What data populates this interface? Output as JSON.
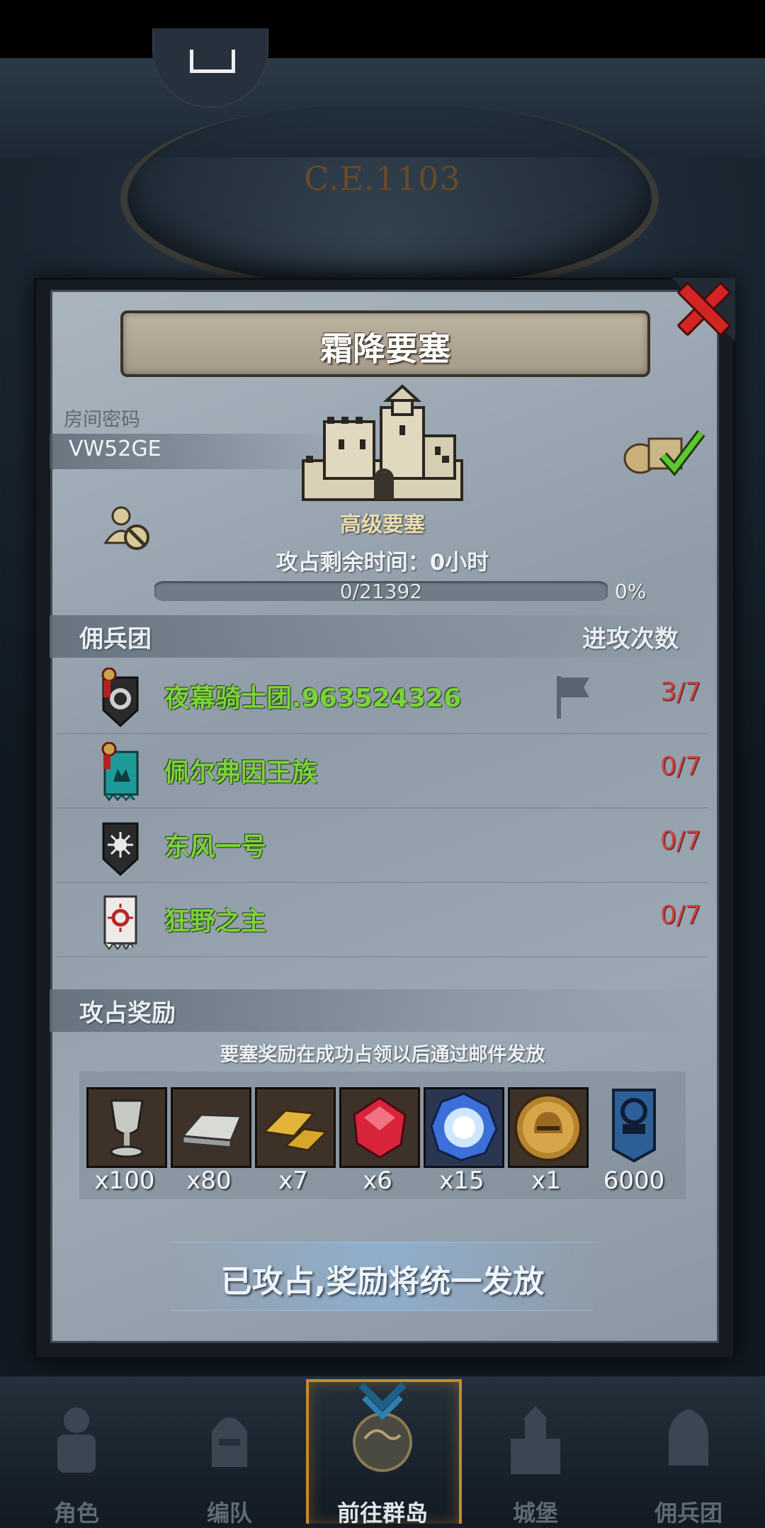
{
  "header": {
    "era_text": "C.E.1103"
  },
  "dialog": {
    "title": "霜降要塞",
    "room_label": "房间密码",
    "room_code": "VW52GE",
    "fortress_type": "高级要塞",
    "remaining_time": "攻占剩余时间：0小时",
    "progress": {
      "text": "0/21392",
      "percent_text": "0%",
      "value": 0,
      "max": 21392
    },
    "mercenary_header": "佣兵团",
    "attack_header": "进攻次数",
    "mercenaries": [
      {
        "name": "夜幕骑士团.963524326",
        "count": "3/7",
        "badge": "black-ring-shield-icon",
        "flag": true
      },
      {
        "name": "佩尔弗因王族",
        "count": "0/7",
        "badge": "teal-crown-banner-icon",
        "flag": false
      },
      {
        "name": "东风一号",
        "count": "0/7",
        "badge": "sun-shield-icon",
        "flag": false
      },
      {
        "name": "狂野之主",
        "count": "0/7",
        "badge": "red-sun-banner-icon",
        "flag": false
      }
    ],
    "reward_header": "攻占奖励",
    "reward_note": "要塞奖励在成功占领以后通过邮件发放",
    "rewards": [
      {
        "icon": "silver-goblet-icon",
        "count": "x100"
      },
      {
        "icon": "silver-ingot-icon",
        "count": "x80"
      },
      {
        "icon": "gold-bars-icon",
        "count": "x7"
      },
      {
        "icon": "red-gem-icon",
        "count": "x6"
      },
      {
        "icon": "blue-crystal-icon",
        "count": "x15"
      },
      {
        "icon": "golden-helmet-coin-icon",
        "count": "x1"
      },
      {
        "icon": "blue-banner-icon",
        "count": "6000"
      }
    ],
    "claim_text": "已攻占,奖励将统一发放",
    "colors": {
      "name_green": "#7ad23c",
      "count_red": "#cf4040",
      "close_red": "#d22424"
    }
  },
  "nav": {
    "items": [
      {
        "label": "角色",
        "icon": "knight-icon"
      },
      {
        "label": "编队",
        "icon": "formation-icon"
      },
      {
        "label": "前往群岛",
        "icon": "globe-icon"
      },
      {
        "label": "城堡",
        "icon": "castle-icon"
      },
      {
        "label": "佣兵团",
        "icon": "mercenary-icon"
      }
    ],
    "active_index": 2
  }
}
